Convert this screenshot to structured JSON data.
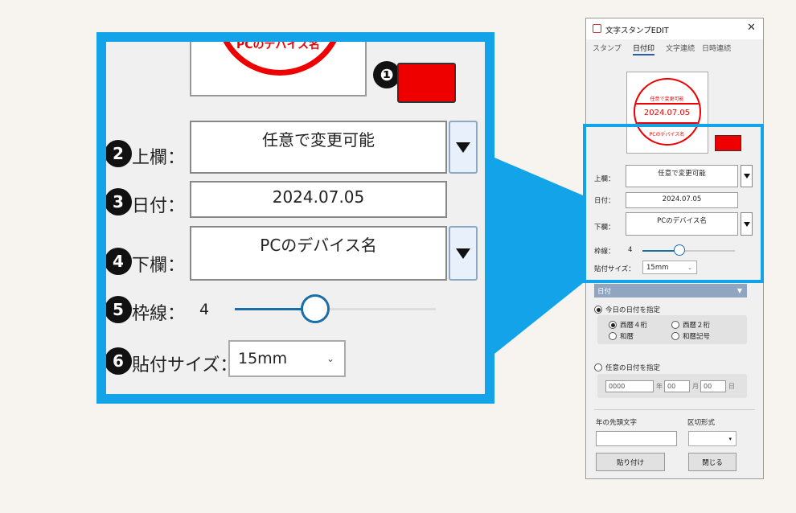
{
  "zoom": {
    "stamp_bottom_text": "PCのデバイス名",
    "badges": [
      "❶",
      "2",
      "3",
      "4",
      "5",
      "6"
    ],
    "upper_label": "上欄：",
    "upper_value": "任意で変更可能",
    "date_label": "日付：",
    "date_value": "2024.07.05",
    "lower_label": "下欄：",
    "lower_value": "PCのデバイス名",
    "border_label": "枠線：",
    "border_value": "4",
    "border_level": 0.4,
    "size_label": "貼付サイズ：",
    "size_value": "15mm",
    "stamp_color": "#ee0000",
    "accent_color": "#12a3e8"
  },
  "dialog": {
    "title": "文字スタンプEDIT",
    "close_icon": "close-icon",
    "tabs": [
      "スタンプ",
      "日付印",
      "文字連続",
      "日時連続"
    ],
    "active_tab": "日付印",
    "stamp_top": "任意で変更可能",
    "stamp_date": "2024.07.05",
    "stamp_bottom": "PCのデバイス名",
    "upper_label": "上欄：",
    "upper_value": "任意で変更可能",
    "date_label": "日付：",
    "date_value": "2024.07.05",
    "lower_label": "下欄：",
    "lower_value": "PCのデバイス名",
    "border_label": "枠線：",
    "border_value": "4",
    "size_label": "貼付サイズ：",
    "size_value": "15mm",
    "section_label": "日付",
    "today_label": "今日の日付を指定",
    "western4": "西暦４桁",
    "western2": "西暦２桁",
    "japanese": "和暦",
    "japanese_symbol": "和暦記号",
    "custom_label": "任意の日付を指定",
    "year_value": "0000",
    "year_unit": "年",
    "month_value": "00",
    "month_unit": "月",
    "day_value": "00",
    "day_unit": "日",
    "prefix_label": "年の先頭文字",
    "separator_label": "区切形式",
    "paste_button": "貼り付け",
    "close_button": "閉じる"
  }
}
